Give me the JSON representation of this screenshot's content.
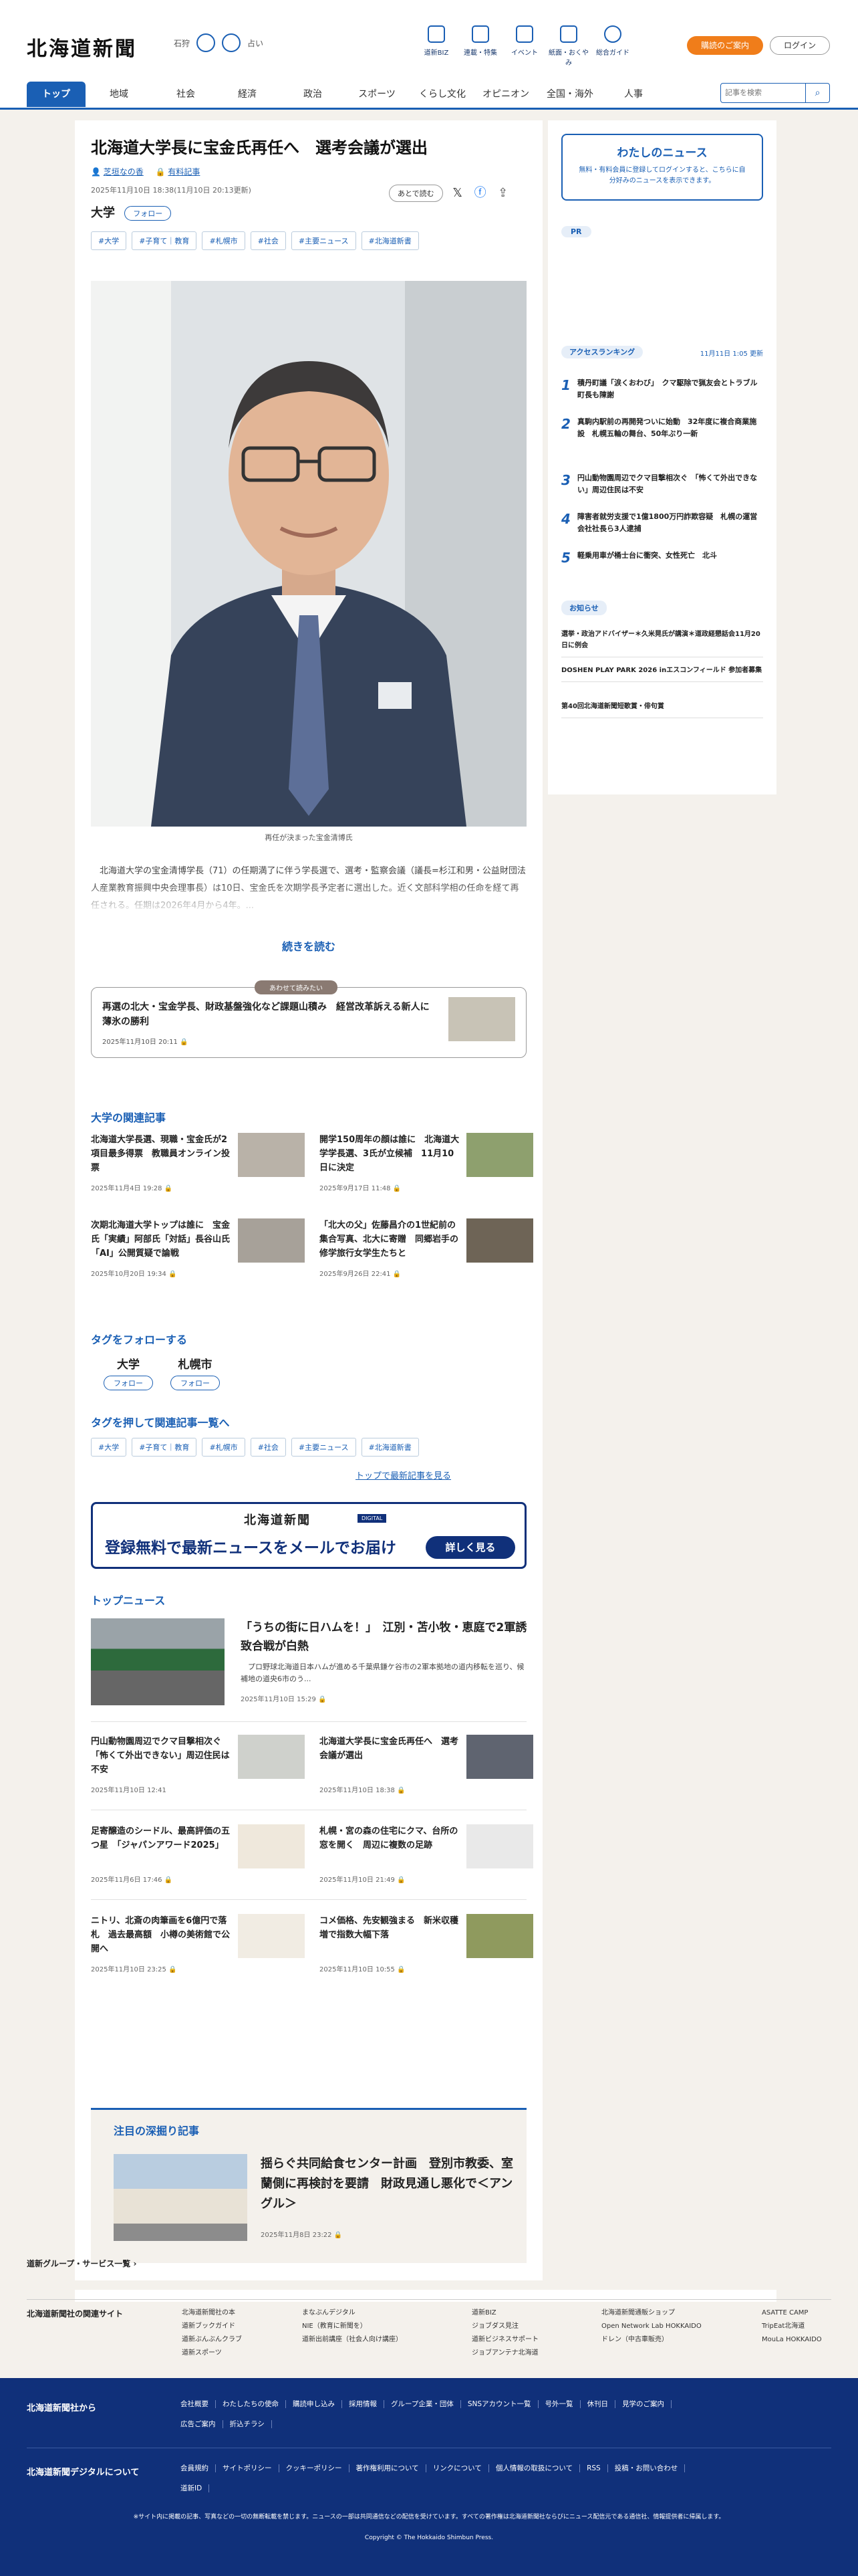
{
  "header": {
    "logo": "北海道新聞",
    "weather": {
      "city": "石狩",
      "label": "占い"
    },
    "nav": [
      "道新BIZ",
      "連載・特集",
      "イベント",
      "紙面・おくやみ",
      "総合ガイド"
    ],
    "subscribe": "購読のご案内",
    "login": "ログイン"
  },
  "gnav": {
    "tabs": [
      "トップ",
      "地域",
      "社会",
      "経済",
      "政治",
      "スポーツ",
      "くらし文化",
      "オピニオン",
      "全国・海外",
      "人事"
    ],
    "search_placeholder": "記事を検索"
  },
  "article": {
    "title": "北海道大学長に宝金氏再任へ　選考会議が選出",
    "author": "芝垣なの香",
    "paid": "有料記事",
    "dates": "2025年11月10日 18:38(11月10日 20:13更新)",
    "kicker": "大学",
    "follow": "フォロー",
    "save": "あとで読む",
    "tags": [
      "#大学",
      "#子育て｜教育",
      "#札幌市",
      "#社会",
      "#主要ニュース",
      "#北海道新書"
    ],
    "caption": "再任が決まった宝金清博氏",
    "lead": "　北海道大学の宝金清博学長（71）の任期満了に伴う学長選で、選考・監察会議（議長=杉江和男・公益財団法人産業教育振興中央会理事長）は10日、宝金氏を次期学長予定者に選出した。近く文部科学相の任命を経て再任される。任期は2026年4月から4年。...",
    "read_more": "続きを読む",
    "also_label": "あわせて読みたい",
    "also_title": "再選の北大・宝金学長、財政基盤強化など課題山積み　経営改革訴える新人に薄氷の勝利",
    "also_date": "2025年11月10日 20:11"
  },
  "related": {
    "heading": "大学の関連記事",
    "items": [
      {
        "title": "北海道大学長選、現職・宝金氏が2項目最多得票　教職員オンライン投票",
        "date": "2025年11月4日 19:28"
      },
      {
        "title": "開学150周年の顔は誰に　北海道大学学長選、3氏が立候補　11月10日に決定",
        "date": "2025年9月17日 11:48"
      },
      {
        "title": "次期北海道大学トップは誰に　宝金氏「実績」阿部氏「対話」長谷山氏「AI」公開質疑で論戦",
        "date": "2025年10月20日 19:34"
      },
      {
        "title": "「北大の父」佐藤昌介の1世紀前の集合写真、北大に寄贈　同郷岩手の修学旅行女学生たちと",
        "date": "2025年9月26日 22:41"
      }
    ]
  },
  "follow_tags": {
    "heading": "タグをフォローする",
    "items": [
      {
        "name": "大学",
        "btn": "フォロー"
      },
      {
        "name": "札幌市",
        "btn": "フォロー"
      }
    ]
  },
  "tag_list": {
    "heading": "タグを押して関連記事一覧へ",
    "items": [
      "#大学",
      "#子育て｜教育",
      "#札幌市",
      "#社会",
      "#主要ニュース",
      "#北海道新書"
    ],
    "latest": "トップで最新記事を見る"
  },
  "banner": {
    "logo": "北海道新聞",
    "digital": "DIGITAL",
    "text": "登録無料で最新ニュースをメールでお届け",
    "button": "詳しく見る"
  },
  "top_news": {
    "heading": "トップニュース",
    "lead": {
      "title": "「うちの街に日ハムを！」　江別・苫小牧・恵庭で2軍誘致合戦が白熱",
      "desc": "　プロ野球北海道日本ハムが進める千葉県鎌ケ谷市の2軍本拠地の道内移転を巡り、候補地の道央6市のう...",
      "date": "2025年11月10日 15:29"
    },
    "items": [
      {
        "title": "円山動物園周辺でクマ目撃相次ぐ　「怖くて外出できない」周辺住民は不安",
        "date": "2025年11月10日 12:41"
      },
      {
        "title": "北海道大学長に宝金氏再任へ　選考会議が選出",
        "date": "2025年11月10日 18:38"
      },
      {
        "title": "足寄醸造のシードル、最高評価の五つ星　「ジャパンアワード2025」",
        "date": "2025年11月6日 17:46"
      },
      {
        "title": "札幌・宮の森の住宅にクマ、台所の窓を開く　周辺に複数の足跡",
        "date": "2025年11月10日 21:49"
      },
      {
        "title": "ニトリ、北斎の肉筆画を6億円で落札　過去最高額　小樽の美術館で公開へ",
        "date": "2025年11月10日 23:25"
      },
      {
        "title": "コメ価格、先安観強まる　新米収穫増で指数大幅下落",
        "date": "2025年11月10日 10:55"
      }
    ]
  },
  "deep": {
    "heading": "注目の深掘り記事",
    "title": "揺らぐ共同給食センター計画　登別市教委、室蘭側に再検討を要請　財政見通し悪化で＜アングル＞",
    "date": "2025年11月8日 23:22"
  },
  "aside": {
    "mynews_title": "わたしのニュース",
    "mynews_desc": "無料・有料会員に登録してログインすると、こちらに自分好みのニュースを表示できます。",
    "pr": "PR",
    "ranking_title": "アクセスランキング",
    "ranking_date": "11月11日 1:05 更新",
    "ranking": [
      "積丹町議「涙くおわび」　クマ駆除で猟友会とトラブル　町長も陳謝",
      "真駒内駅前の再開発ついに始動　32年度に複合商業施設　札幌五輪の舞台、50年ぶり一新",
      "円山動物園周辺でクマ目撃相次ぐ　「怖くて外出できない」周辺住民は不安",
      "障害者就労支援で1億1800万円詐欺容疑　札幌の運営会社社長ら3人逮捕",
      "軽乗用車が桶士台に衝突、女性死亡　北斗"
    ],
    "notice_title": "お知らせ",
    "notices": [
      "選挙・政治アドバイザー＊久米晃氏が講演＊道政経懇話会11月20日に例会",
      "DOSHEN PLAY PARK 2026 inエスコンフィールド 参加者募集",
      "第40回北海道新聞短歌賞・俳句賞"
    ]
  },
  "footer": {
    "group_link": "道新グループ・サービス一覧",
    "sites_heading": "北海道新聞社の関連サイト",
    "sites": [
      [
        "北海道新聞社の本",
        "道新ブックガイド",
        "道新ぶんぶんクラブ",
        "道新スポーツ"
      ],
      [
        "まなぶんデジタル",
        "NIE（教育に新聞を）",
        "道新出前講座（社会人向け講座）"
      ],
      [
        "道新BIZ",
        "ジョブダス見注",
        "道新ビジネスサポート",
        "ジョブアンテナ北海道"
      ],
      [
        "北海道新聞通販ショップ",
        "Open Network Lab HOKKAIDO",
        "ドレン（中古車販売）"
      ],
      [
        "ASATTE CAMP",
        "TripEat北海道",
        "MouLa HOKKAIDO"
      ]
    ],
    "from_heading": "北海道新聞社から",
    "from_links": [
      "会社概要",
      "わたしたちの使命",
      "購読申し込み",
      "採用情報",
      "グループ企業・団体",
      "SNSアカウント一覧",
      "号外一覧",
      "休刊日",
      "見学のご案内",
      "広告ご案内",
      "折込チラシ"
    ],
    "digital_heading": "北海道新聞デジタルについて",
    "digital_links": [
      "会員規約",
      "サイトポリシー",
      "クッキーポリシー",
      "著作権利用について",
      "リンクについて",
      "個人情報の取扱について",
      "RSS",
      "投稿・お問い合わせ",
      "道新ID"
    ],
    "notice": "※サイト内に掲載の記事、写真などの一切の無断転載を禁じます。ニュースの一部は共同通信などの配信を受けています。すべての著作権は北海道新聞社ならびにニュース配信元である通信社、情報提供者に帰属します。",
    "copyright": "Copyright © The Hokkaido Shimbun Press."
  },
  "colors": {
    "brand": "#1a5fb4",
    "navy": "#10307a",
    "accent": "#f07d1a",
    "bg": "#f4f1ec"
  }
}
